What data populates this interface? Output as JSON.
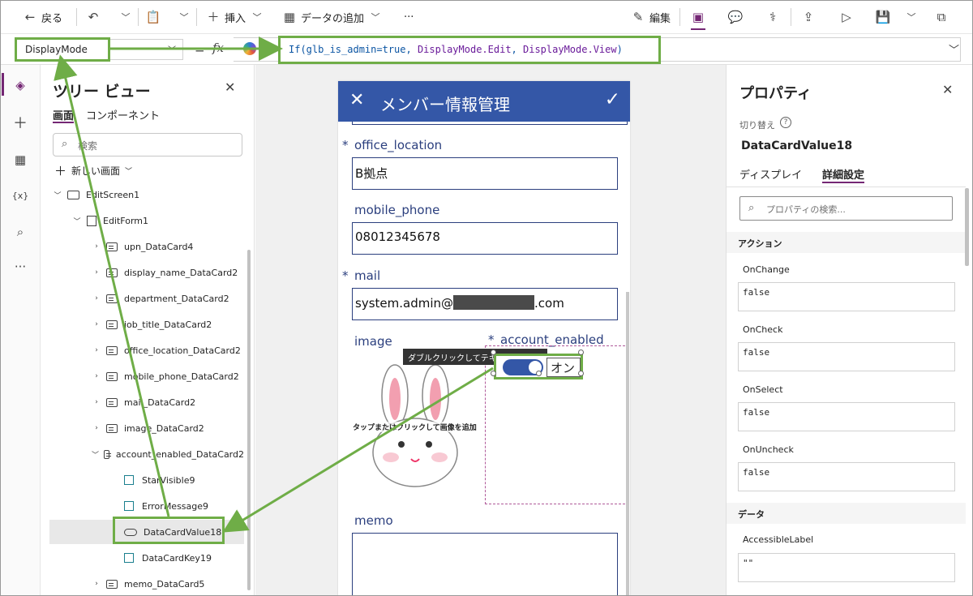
{
  "toolbar": {
    "back_label": "戻る",
    "insert_label": "挿入",
    "add_data_label": "データの追加",
    "more_label": "···",
    "edit_label": "編集"
  },
  "formula_bar": {
    "property": "DisplayMode",
    "equals": "=",
    "fx": "fx",
    "formula": {
      "part1": "If(glb_is_admin=true, ",
      "part2": "DisplayMode.Edit",
      "part3": ", ",
      "part4": "DisplayMode.View",
      "part5": ")"
    }
  },
  "tree": {
    "title": "ツリー ビュー",
    "tabs": [
      "画面",
      "コンポーネント"
    ],
    "search_placeholder": "検索",
    "new_screen_label": "新しい画面",
    "items": [
      {
        "label": "EditScreen1"
      },
      {
        "label": "EditForm1"
      },
      {
        "label": "upn_DataCard4"
      },
      {
        "label": "display_name_DataCard2"
      },
      {
        "label": "department_DataCard2"
      },
      {
        "label": "job_title_DataCard2"
      },
      {
        "label": "office_location_DataCard2"
      },
      {
        "label": "mobile_phone_DataCard2"
      },
      {
        "label": "mail_DataCard2"
      },
      {
        "label": "image_DataCard2"
      },
      {
        "label": "account_enabled_DataCard2"
      },
      {
        "label": "StarVisible9"
      },
      {
        "label": "ErrorMessage9"
      },
      {
        "label": "DataCardValue18"
      },
      {
        "label": "DataCardKey19"
      },
      {
        "label": "memo_DataCard5"
      }
    ]
  },
  "form": {
    "title": "メンバー情報管理",
    "office_location_label": "office_location",
    "office_location_value": "B拠点",
    "mobile_phone_label": "mobile_phone",
    "mobile_phone_value": "08012345678",
    "mail_label": "mail",
    "mail_prefix": "system.admin@",
    "mail_suffix": ".com",
    "image_label": "image",
    "image_hint": "タップまたはクリックして画像を追加",
    "account_enabled_label": "account_enabled",
    "toggle_text": "オン",
    "tooltip": "ダブルクリックしてテキストを編集します",
    "memo_label": "memo",
    "required_mark": "*"
  },
  "props": {
    "title": "プロパティ",
    "toggle_label": "切り替え",
    "control_name": "DataCardValue18",
    "tabs": [
      "ディスプレイ",
      "詳細設定"
    ],
    "search_placeholder": "プロパティの検索...",
    "sections": {
      "actions": "アクション",
      "data": "データ"
    },
    "fields": [
      {
        "label": "OnChange",
        "value": "false"
      },
      {
        "label": "OnCheck",
        "value": "false"
      },
      {
        "label": "OnSelect",
        "value": "false"
      },
      {
        "label": "OnUncheck",
        "value": "false"
      }
    ],
    "accessible_label": "AccessibleLabel",
    "accessible_value": "\"\""
  },
  "colors": {
    "header_blue": "#3457a7",
    "annotation_green": "#6fad47",
    "form_text": "#2b3f7e",
    "accent": "#742774"
  }
}
